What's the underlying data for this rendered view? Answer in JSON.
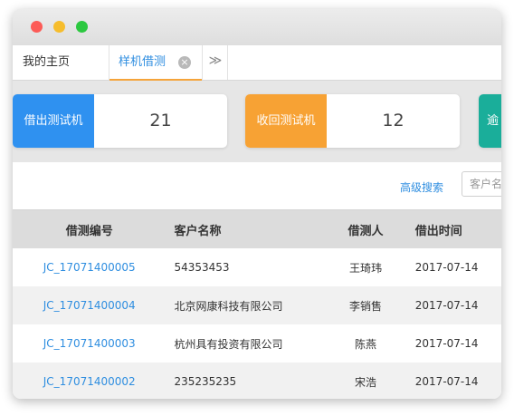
{
  "tabs": {
    "home_label": "我的主页",
    "active_label": "样机借测",
    "close_glyph": "×",
    "more_glyph": "≫"
  },
  "cards": [
    {
      "label": "借出测试机",
      "value": "21",
      "color": "#2f91f0"
    },
    {
      "label": "收回测试机",
      "value": "12",
      "color": "#f7a234"
    },
    {
      "label": "逾",
      "color": "#1aae9a"
    }
  ],
  "toolbar": {
    "advanced_search": "高级搜索",
    "search_placeholder": "客户名称"
  },
  "table": {
    "columns": [
      "借测编号",
      "客户名称",
      "借测人",
      "借出时间"
    ],
    "rows": [
      [
        "JC_17071400005",
        "54353453",
        "王琦玮",
        "2017-07-14"
      ],
      [
        "JC_17071400004",
        "北京网康科技有限公司",
        "李销售",
        "2017-07-14"
      ],
      [
        "JC_17071400003",
        "杭州具有投资有限公司",
        "陈燕",
        "2017-07-14"
      ],
      [
        "JC_17071400002",
        "235235235",
        "宋浩",
        "2017-07-14"
      ]
    ]
  }
}
